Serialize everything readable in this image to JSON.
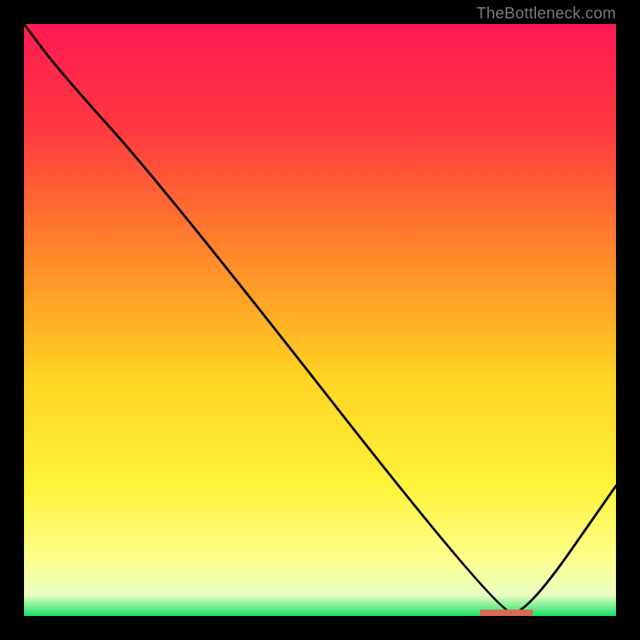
{
  "watermark": "TheBottleneck.com",
  "chart_data": {
    "type": "line",
    "title": "",
    "xlabel": "",
    "ylabel": "",
    "xlim": [
      0,
      100
    ],
    "ylim": [
      0,
      100
    ],
    "grid": false,
    "legend": false,
    "series": [
      {
        "name": "curve",
        "x": [
          0,
          6,
          24,
          80,
          85,
          100
        ],
        "values": [
          100,
          92,
          72,
          0.5,
          0.5,
          22
        ]
      }
    ],
    "gradient_stops": [
      {
        "offset": 0,
        "color": "#ff1a54"
      },
      {
        "offset": 0.18,
        "color": "#ff3a3f"
      },
      {
        "offset": 0.4,
        "color": "#ff8b2a"
      },
      {
        "offset": 0.6,
        "color": "#ffd423"
      },
      {
        "offset": 0.78,
        "color": "#fff33a"
      },
      {
        "offset": 0.9,
        "color": "#fdff8a"
      },
      {
        "offset": 0.965,
        "color": "#eaffc0"
      },
      {
        "offset": 1.0,
        "color": "#18e06a"
      }
    ],
    "marker": {
      "x_start": 77,
      "x_end": 86,
      "y": 0.6,
      "color": "#d66a5b"
    }
  }
}
